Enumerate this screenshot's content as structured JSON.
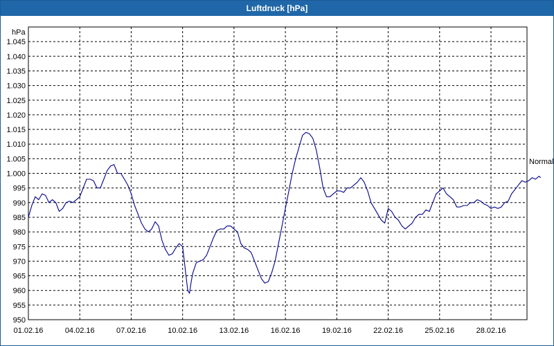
{
  "window": {
    "title": "Luftdruck [hPa]"
  },
  "chart_data": {
    "type": "line",
    "title": "Luftdruck [hPa]",
    "unit_label": "hPa",
    "ylim": [
      950,
      1050
    ],
    "y_ticks": [
      "950",
      "955",
      "960",
      "965",
      "970",
      "975",
      "980",
      "985",
      "990",
      "995",
      "1.000",
      "1.005",
      "1.010",
      "1.015",
      "1.020",
      "1.025",
      "1.030",
      "1.035",
      "1.040",
      "1.045"
    ],
    "x_ticks": [
      "01.02.16",
      "04.02.16",
      "07.02.16",
      "10.02.16",
      "13.02.16",
      "16.02.16",
      "19.02.16",
      "22.02.16",
      "25.02.16",
      "28.02.16"
    ],
    "xlim_days": [
      1,
      30.1
    ],
    "grid": true,
    "reference_label": "Normal",
    "series": [
      {
        "color": "#00008b",
        "points": [
          [
            1.0,
            985
          ],
          [
            1.2,
            989
          ],
          [
            1.4,
            992
          ],
          [
            1.6,
            991
          ],
          [
            1.8,
            993
          ],
          [
            2.0,
            992.5
          ],
          [
            2.2,
            990
          ],
          [
            2.4,
            991
          ],
          [
            2.6,
            990
          ],
          [
            2.8,
            987
          ],
          [
            3.0,
            988
          ],
          [
            3.2,
            990
          ],
          [
            3.4,
            990.5
          ],
          [
            3.6,
            990
          ],
          [
            3.8,
            991
          ],
          [
            4.0,
            992
          ],
          [
            4.2,
            995
          ],
          [
            4.4,
            998
          ],
          [
            4.6,
            998
          ],
          [
            4.8,
            997.5
          ],
          [
            5.0,
            995
          ],
          [
            5.2,
            995
          ],
          [
            5.4,
            998
          ],
          [
            5.6,
            1001
          ],
          [
            5.8,
            1002.5
          ],
          [
            6.0,
            1003
          ],
          [
            6.2,
            1000
          ],
          [
            6.4,
            1000
          ],
          [
            6.6,
            998
          ],
          [
            6.8,
            996
          ],
          [
            7.0,
            993
          ],
          [
            7.2,
            989
          ],
          [
            7.4,
            986
          ],
          [
            7.6,
            983
          ],
          [
            7.8,
            981
          ],
          [
            8.0,
            980
          ],
          [
            8.2,
            981
          ],
          [
            8.4,
            983.5
          ],
          [
            8.6,
            982
          ],
          [
            8.8,
            977
          ],
          [
            9.0,
            974
          ],
          [
            9.2,
            972
          ],
          [
            9.4,
            972.5
          ],
          [
            9.6,
            974.5
          ],
          [
            9.8,
            976
          ],
          [
            10.0,
            975
          ],
          [
            10.1,
            970
          ],
          [
            10.2,
            965
          ],
          [
            10.3,
            960
          ],
          [
            10.4,
            959
          ],
          [
            10.5,
            963
          ],
          [
            10.6,
            966
          ],
          [
            10.8,
            969.5
          ],
          [
            11.0,
            970
          ],
          [
            11.2,
            970.5
          ],
          [
            11.4,
            972
          ],
          [
            11.6,
            975
          ],
          [
            11.8,
            978
          ],
          [
            12.0,
            980.5
          ],
          [
            12.2,
            981
          ],
          [
            12.4,
            981
          ],
          [
            12.6,
            982
          ],
          [
            12.8,
            982
          ],
          [
            13.0,
            981
          ],
          [
            13.2,
            980
          ],
          [
            13.4,
            976
          ],
          [
            13.6,
            974.5
          ],
          [
            13.8,
            974
          ],
          [
            14.0,
            973
          ],
          [
            14.2,
            970
          ],
          [
            14.4,
            967
          ],
          [
            14.6,
            964
          ],
          [
            14.8,
            962.5
          ],
          [
            15.0,
            963
          ],
          [
            15.2,
            966
          ],
          [
            15.4,
            970
          ],
          [
            15.6,
            976
          ],
          [
            15.8,
            982
          ],
          [
            16.0,
            988
          ],
          [
            16.2,
            994
          ],
          [
            16.4,
            1000
          ],
          [
            16.6,
            1005
          ],
          [
            16.8,
            1009
          ],
          [
            17.0,
            1013
          ],
          [
            17.2,
            1014
          ],
          [
            17.4,
            1013.5
          ],
          [
            17.6,
            1012
          ],
          [
            17.8,
            1008
          ],
          [
            18.0,
            1002
          ],
          [
            18.2,
            995
          ],
          [
            18.4,
            992
          ],
          [
            18.6,
            992
          ],
          [
            18.8,
            993
          ],
          [
            19.0,
            994
          ],
          [
            19.2,
            994
          ],
          [
            19.4,
            993.5
          ],
          [
            19.6,
            995
          ],
          [
            19.8,
            995
          ],
          [
            20.0,
            996
          ],
          [
            20.2,
            997
          ],
          [
            20.4,
            998.5
          ],
          [
            20.6,
            997
          ],
          [
            20.8,
            994
          ],
          [
            21.0,
            990
          ],
          [
            21.2,
            988
          ],
          [
            21.4,
            986
          ],
          [
            21.6,
            984
          ],
          [
            21.8,
            983
          ],
          [
            22.0,
            988
          ],
          [
            22.2,
            987
          ],
          [
            22.4,
            985
          ],
          [
            22.6,
            984
          ],
          [
            22.8,
            982
          ],
          [
            23.0,
            981
          ],
          [
            23.2,
            982
          ],
          [
            23.4,
            983
          ],
          [
            23.6,
            985
          ],
          [
            23.8,
            986
          ],
          [
            24.0,
            986
          ],
          [
            24.2,
            987.5
          ],
          [
            24.4,
            987
          ],
          [
            24.6,
            990
          ],
          [
            24.8,
            993
          ],
          [
            25.0,
            994
          ],
          [
            25.2,
            995
          ],
          [
            25.4,
            993
          ],
          [
            25.6,
            992
          ],
          [
            25.8,
            991
          ],
          [
            26.0,
            988.5
          ],
          [
            26.2,
            988.5
          ],
          [
            26.4,
            989
          ],
          [
            26.6,
            989
          ],
          [
            26.8,
            990
          ],
          [
            27.0,
            990
          ],
          [
            27.2,
            991
          ],
          [
            27.4,
            990.5
          ],
          [
            27.6,
            989.5
          ],
          [
            27.8,
            989
          ],
          [
            28.0,
            988
          ],
          [
            28.2,
            988.5
          ],
          [
            28.4,
            988
          ],
          [
            28.6,
            988.5
          ],
          [
            28.8,
            990
          ],
          [
            29.0,
            990.5
          ],
          [
            29.2,
            993
          ],
          [
            29.4,
            994.5
          ],
          [
            29.6,
            996
          ],
          [
            29.8,
            997.5
          ],
          [
            30.0,
            997
          ],
          [
            30.2,
            997.5
          ],
          [
            30.4,
            998.5
          ],
          [
            30.6,
            998
          ],
          [
            30.8,
            999
          ],
          [
            30.9,
            998.5
          ]
        ]
      }
    ]
  }
}
